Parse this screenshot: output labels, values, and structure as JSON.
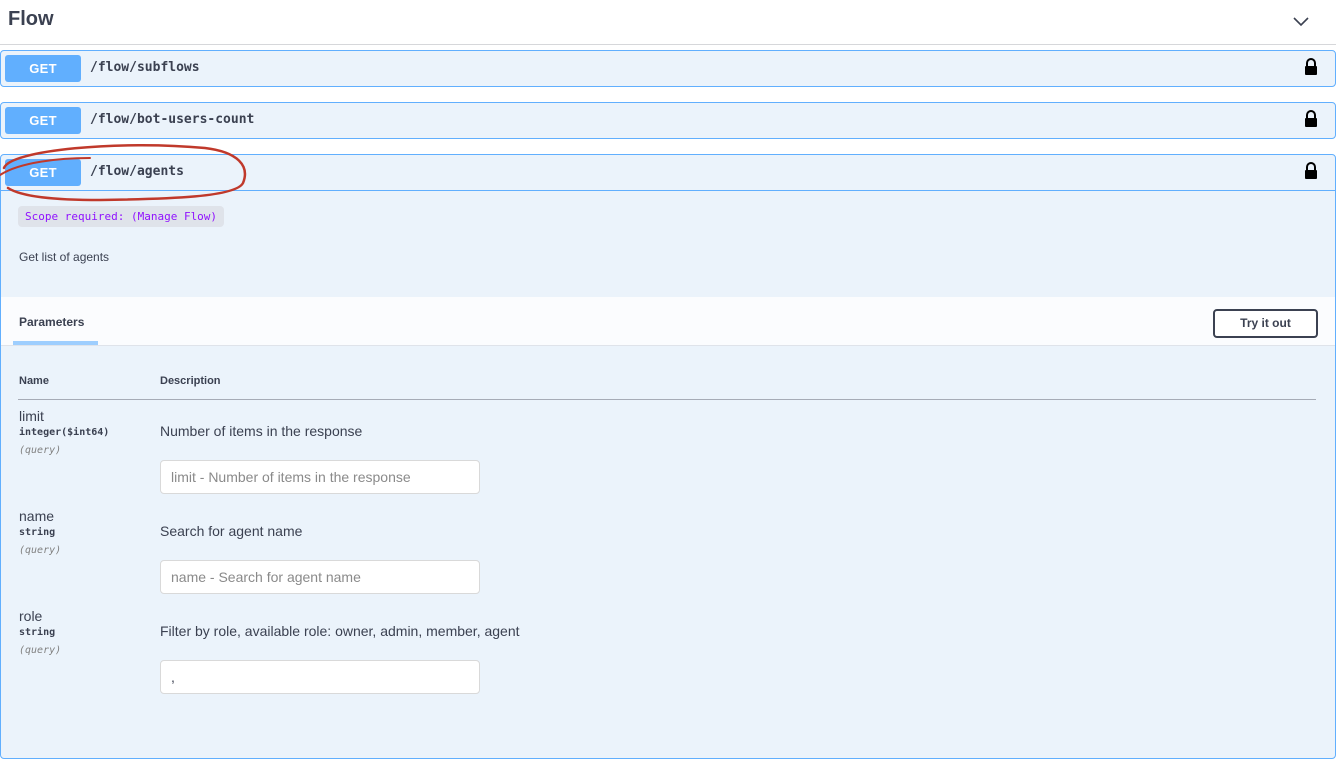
{
  "section": {
    "title": "Flow",
    "chevron_icon": "chevron-down-icon"
  },
  "operations": [
    {
      "method": "GET",
      "path": "/flow/subflows",
      "lock_icon": "lock-icon"
    },
    {
      "method": "GET",
      "path": "/flow/bot-users-count",
      "lock_icon": "lock-icon"
    },
    {
      "method": "GET",
      "path": "/flow/agents",
      "lock_icon": "lock-icon",
      "expanded": true
    }
  ],
  "expanded_op": {
    "scope": "Scope required: (Manage Flow)",
    "description": "Get list of agents",
    "params_tab": "Parameters",
    "try_button": "Try it out",
    "col_name": "Name",
    "col_description": "Description",
    "params": [
      {
        "name": "limit",
        "type": "integer($int64)",
        "in": "(query)",
        "description": "Number of items in the response",
        "value": "",
        "placeholder": "limit - Number of items in the response"
      },
      {
        "name": "name",
        "type": "string",
        "in": "(query)",
        "description": "Search for agent name",
        "value": "",
        "placeholder": "name - Search for agent name"
      },
      {
        "name": "role",
        "type": "string",
        "in": "(query)",
        "description": "Filter by role, available role: owner, admin, member, agent",
        "value": ",",
        "placeholder": ""
      }
    ]
  },
  "colors": {
    "get_method": "#61affe",
    "op_background": "#ebf3fb",
    "scope_text": "#9012fe",
    "annotation_circle": "#c0392b"
  }
}
